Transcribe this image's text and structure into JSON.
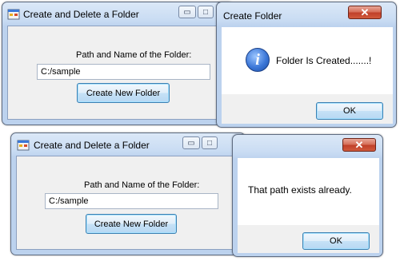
{
  "top_form": {
    "title": "Create and Delete a Folder",
    "path_label": "Path and Name of the Folder:",
    "path_value": "C:/sample",
    "create_button_label": "Create New Folder",
    "minimize_glyph": "▭",
    "maximize_glyph": "□"
  },
  "top_message": {
    "title": "Create Folder",
    "close_glyph": "✕",
    "icon_name": "info-icon",
    "icon_glyph": "i",
    "message": "Folder Is Created.......!",
    "ok_label": "OK"
  },
  "bottom_form": {
    "title": "Create and Delete a Folder",
    "path_label": "Path and Name of the Folder:",
    "path_value": "C:/sample",
    "create_button_label": "Create New Folder",
    "minimize_glyph": "▭",
    "maximize_glyph": "□"
  },
  "bottom_message": {
    "close_glyph": "✕",
    "message": "That path exists already.",
    "ok_label": "OK"
  },
  "colors": {
    "titlebar": "#c9dcf3",
    "client": "#f0f0f0",
    "close_button": "#c0402a",
    "button_border": "#3c7fb1"
  }
}
